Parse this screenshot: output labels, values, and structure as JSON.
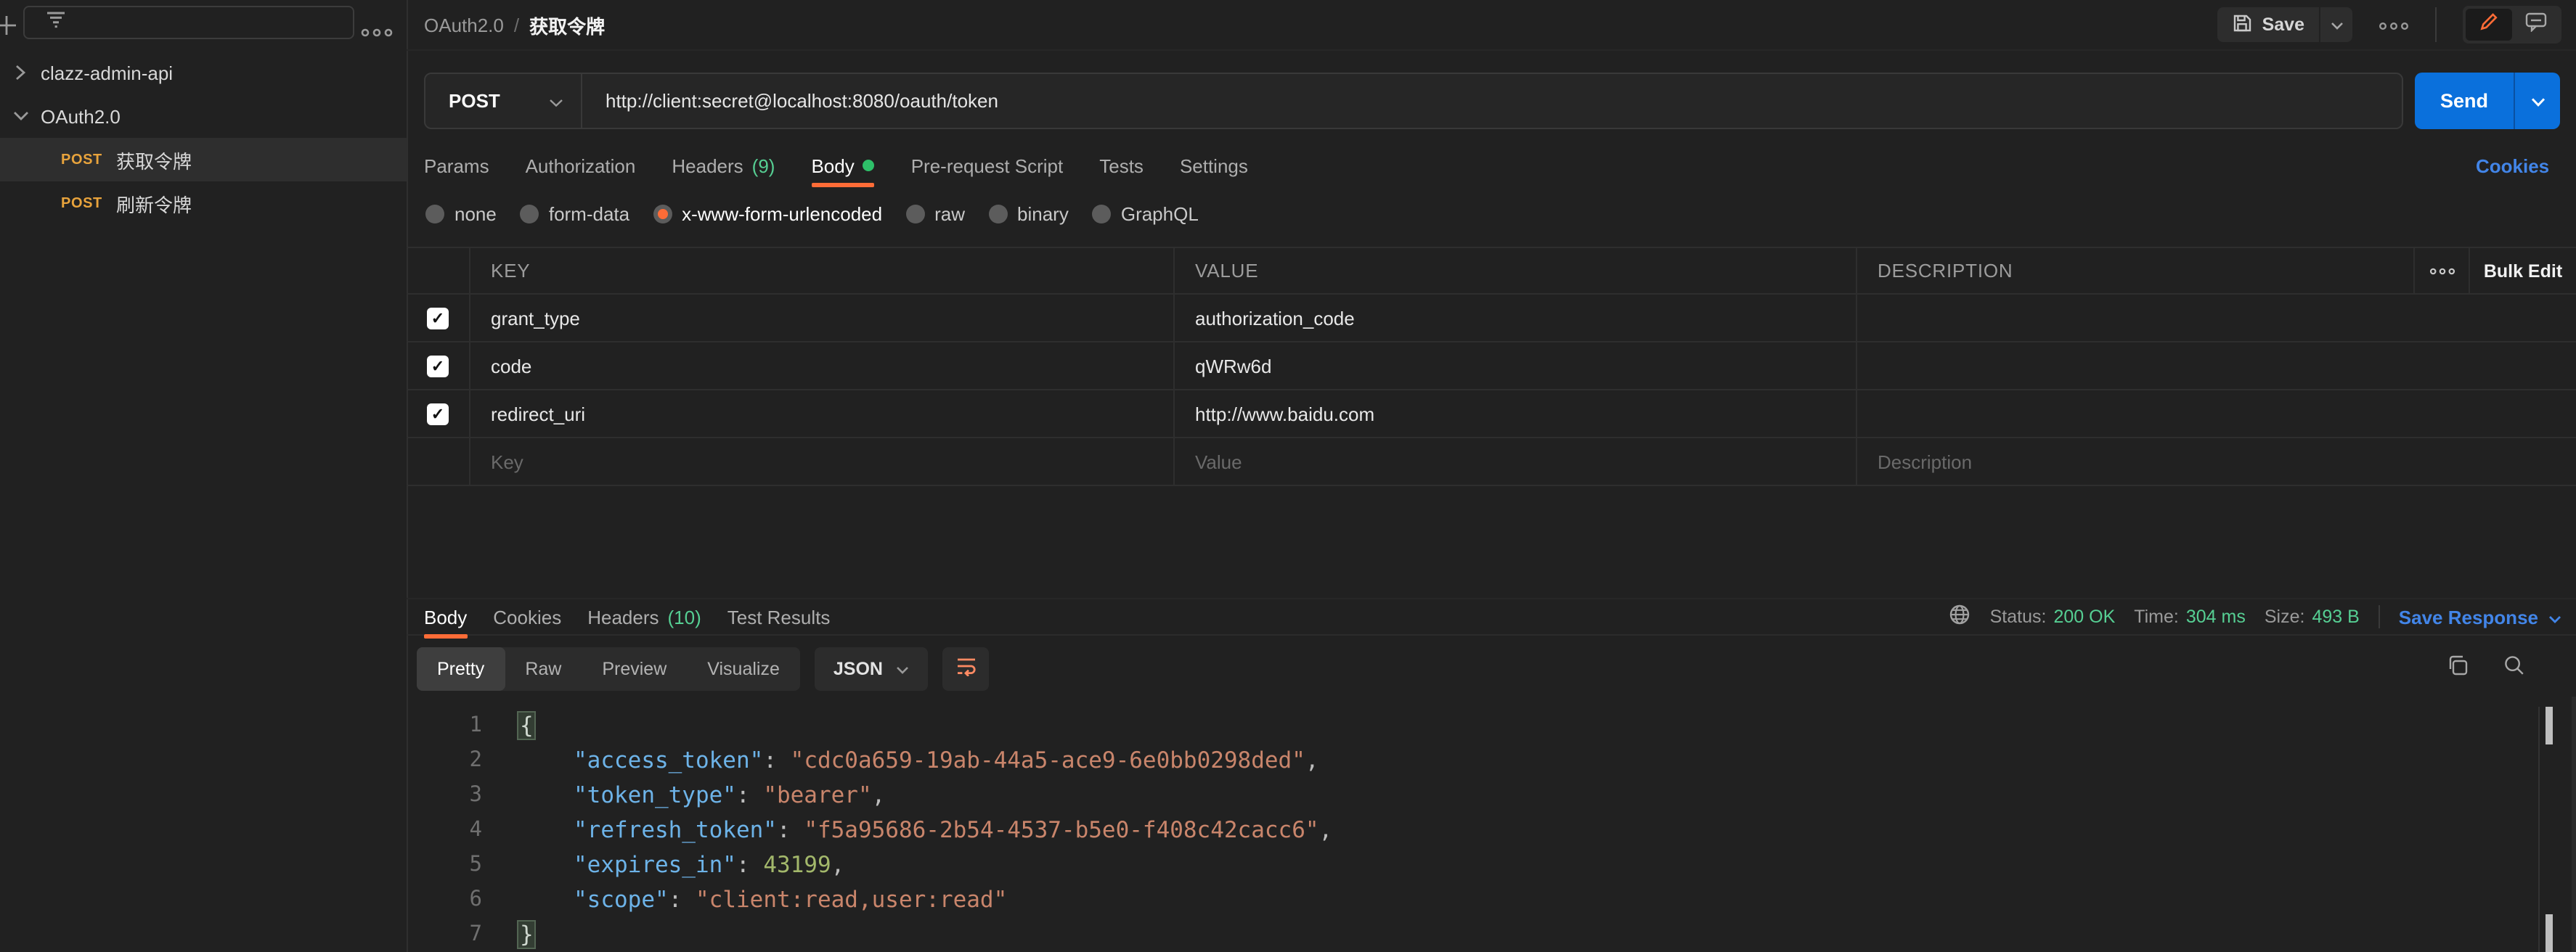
{
  "colors": {
    "accent_orange": "#ff6c37",
    "method_amber": "#e8a33c",
    "success_green": "#56cf93",
    "link_blue": "#4285e8",
    "send_blue": "#0a70dc",
    "body_dot_green": "#2ec069"
  },
  "sidebar": {
    "items": [
      {
        "kind": "collection",
        "label": "clazz-admin-api",
        "state": "collapsed"
      },
      {
        "kind": "folder",
        "label": "OAuth2.0",
        "state": "expanded"
      },
      {
        "kind": "request",
        "method": "POST",
        "label": "获取令牌",
        "selected": true
      },
      {
        "kind": "request",
        "method": "POST",
        "label": "刷新令牌",
        "selected": false
      }
    ]
  },
  "topbar": {
    "breadcrumb": {
      "parent": "OAuth2.0",
      "separator": "/",
      "current": "获取令牌"
    },
    "save_label": "Save"
  },
  "request": {
    "method": "POST",
    "url": "http://client:secret@localhost:8080/oauth/token",
    "send_label": "Send",
    "tabs": [
      {
        "label": "Params"
      },
      {
        "label": "Authorization"
      },
      {
        "label": "Headers",
        "count": "(9)"
      },
      {
        "label": "Body",
        "active": true,
        "has_dot": true
      },
      {
        "label": "Pre-request Script"
      },
      {
        "label": "Tests"
      },
      {
        "label": "Settings"
      }
    ],
    "cookies_link": "Cookies",
    "body_modes": [
      {
        "label": "none"
      },
      {
        "label": "form-data"
      },
      {
        "label": "x-www-form-urlencoded",
        "selected": true
      },
      {
        "label": "raw"
      },
      {
        "label": "binary"
      },
      {
        "label": "GraphQL"
      }
    ],
    "params_table": {
      "columns": [
        "KEY",
        "VALUE",
        "DESCRIPTION"
      ],
      "bulk_edit_label": "Bulk Edit",
      "rows": [
        {
          "checked": true,
          "key": "grant_type",
          "value": "authorization_code",
          "description": ""
        },
        {
          "checked": true,
          "key": "code",
          "value": "qWRw6d",
          "description": ""
        },
        {
          "checked": true,
          "key": "redirect_uri",
          "value": "http://www.baidu.com",
          "description": ""
        }
      ],
      "placeholders": {
        "key": "Key",
        "value": "Value",
        "description": "Description"
      }
    }
  },
  "response": {
    "tabs": [
      {
        "label": "Body",
        "active": true
      },
      {
        "label": "Cookies"
      },
      {
        "label": "Headers",
        "count": "(10)"
      },
      {
        "label": "Test Results"
      }
    ],
    "meta": {
      "status_label": "Status:",
      "status": "200 OK",
      "time_label": "Time:",
      "time": "304 ms",
      "size_label": "Size:",
      "size": "493 B"
    },
    "save_response_label": "Save Response",
    "view_modes": [
      {
        "label": "Pretty",
        "active": true
      },
      {
        "label": "Raw"
      },
      {
        "label": "Preview"
      },
      {
        "label": "Visualize"
      }
    ],
    "language": "JSON",
    "body_json": {
      "access_token": "cdc0a659-19ab-44a5-ace9-6e0bb0298ded",
      "token_type": "bearer",
      "refresh_token": "f5a95686-2b54-4537-b5e0-f408c42cacc6",
      "expires_in": 43199,
      "scope": "client:read,user:read"
    },
    "code_lines": [
      {
        "n": 1,
        "tk": [
          [
            "brace",
            "{"
          ]
        ]
      },
      {
        "n": 2,
        "tk": [
          [
            "key",
            "\"access_token\""
          ],
          [
            "punc",
            ": "
          ],
          [
            "str",
            "\"cdc0a659-19ab-44a5-ace9-6e0bb0298ded\""
          ],
          [
            "punc",
            ","
          ]
        ]
      },
      {
        "n": 3,
        "tk": [
          [
            "key",
            "\"token_type\""
          ],
          [
            "punc",
            ": "
          ],
          [
            "str",
            "\"bearer\""
          ],
          [
            "punc",
            ","
          ]
        ]
      },
      {
        "n": 4,
        "tk": [
          [
            "key",
            "\"refresh_token\""
          ],
          [
            "punc",
            ": "
          ],
          [
            "str",
            "\"f5a95686-2b54-4537-b5e0-f408c42cacc6\""
          ],
          [
            "punc",
            ","
          ]
        ]
      },
      {
        "n": 5,
        "tk": [
          [
            "key",
            "\"expires_in\""
          ],
          [
            "punc",
            ": "
          ],
          [
            "num",
            "43199"
          ],
          [
            "punc",
            ","
          ]
        ]
      },
      {
        "n": 6,
        "tk": [
          [
            "key",
            "\"scope\""
          ],
          [
            "punc",
            ": "
          ],
          [
            "str",
            "\"client:read,user:read\""
          ]
        ]
      },
      {
        "n": 7,
        "tk": [
          [
            "brace",
            "}"
          ]
        ]
      }
    ]
  }
}
